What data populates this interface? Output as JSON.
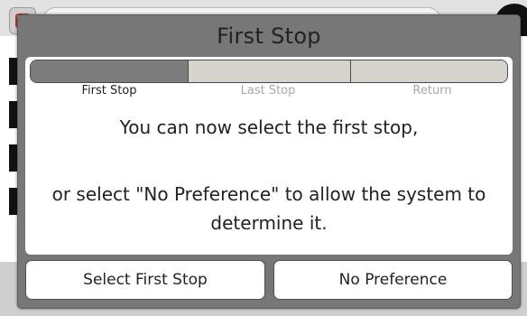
{
  "dialog": {
    "title": "First Stop",
    "steps": [
      {
        "label": "First Stop",
        "active": true
      },
      {
        "label": "Last Stop",
        "active": false
      },
      {
        "label": "Return",
        "active": false
      }
    ],
    "message_line1": "You can now select the first stop,",
    "message_line2": "or select \"No Preference\" to allow the system to determine it.",
    "buttons": {
      "select_first_stop": "Select First Stop",
      "no_preference": "No Preference"
    }
  },
  "colors": {
    "dialog_frame": "#777777",
    "active_step": "#7c7c7c",
    "inactive_step": "#d6d3cc",
    "inactive_step_label": "#a8a8a8"
  },
  "progress": {
    "current_step": 1,
    "total_steps": 3
  }
}
